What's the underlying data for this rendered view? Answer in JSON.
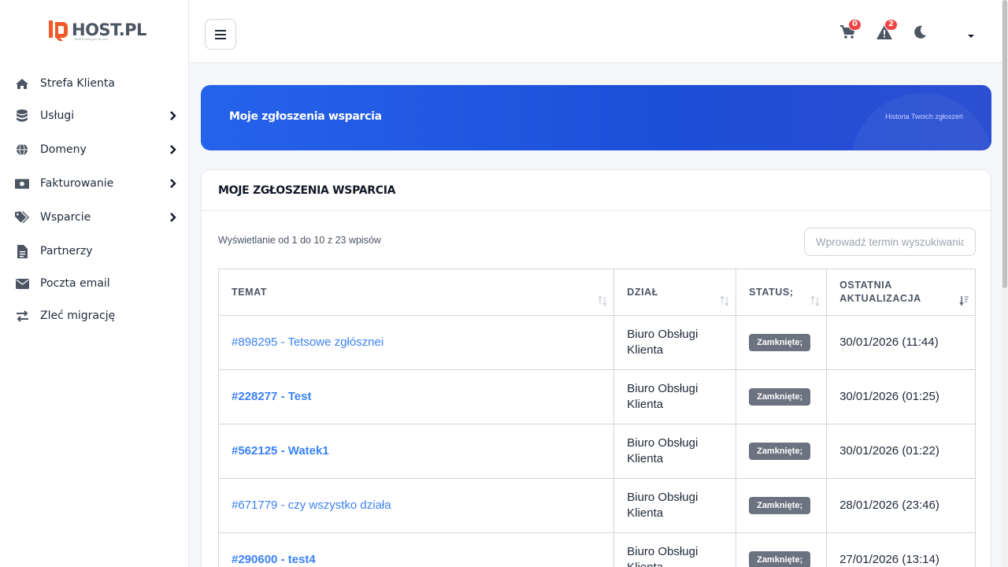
{
  "brand": {
    "name": "HOST.PL",
    "tagline": "Best hosting on the web"
  },
  "sidebar": {
    "items": [
      {
        "label": "Strefa Klienta",
        "icon": "home-icon",
        "has_submenu": false
      },
      {
        "label": "Usługi",
        "icon": "database-icon",
        "has_submenu": true
      },
      {
        "label": "Domeny",
        "icon": "globe-icon",
        "has_submenu": true
      },
      {
        "label": "Fakturowanie",
        "icon": "money-bill-icon",
        "has_submenu": true
      },
      {
        "label": "Wsparcie",
        "icon": "tags-icon",
        "has_submenu": true
      },
      {
        "label": "Partnerzy",
        "icon": "file-text-icon",
        "has_submenu": false
      },
      {
        "label": "Poczta email",
        "icon": "envelope-icon",
        "has_submenu": false
      },
      {
        "label": "Zleć migrację",
        "icon": "exchange-icon",
        "has_submenu": false
      }
    ]
  },
  "topbar": {
    "cart_count": "0",
    "alerts_count": "2"
  },
  "banner": {
    "title": "Moje zgłoszenia wsparcia",
    "subtitle": "Historia Twoich zgłoszeń"
  },
  "card": {
    "title": "MOJE ZGŁOSZENIA WSPARCIA",
    "info": "Wyświetlanie od 1 do 10 z 23 wpisów",
    "search_placeholder": "Wprowadź termin wyszukiwania"
  },
  "table": {
    "headers": [
      "TEMAT",
      "DZIAŁ",
      "STATUS;",
      "OSTATNIA AKTUALIZACJA"
    ],
    "rows": [
      {
        "subject": "#898295 - Tetsowe zgłósznei",
        "bold": false,
        "dept": "Biuro Obsługi Klienta",
        "status": "Zamknięte;",
        "updated": "30/01/2026 (11:44)"
      },
      {
        "subject": "#228277 - Test",
        "bold": true,
        "dept": "Biuro Obsługi Klienta",
        "status": "Zamknięte;",
        "updated": "30/01/2026 (01:25)"
      },
      {
        "subject": "#562125 - Watek1",
        "bold": true,
        "dept": "Biuro Obsługi Klienta",
        "status": "Zamknięte;",
        "updated": "30/01/2026 (01:22)"
      },
      {
        "subject": "#671779 - czy wszystko działa",
        "bold": false,
        "dept": "Biuro Obsługi Klienta",
        "status": "Zamknięte;",
        "updated": "28/01/2026 (23:46)"
      },
      {
        "subject": "#290600 - test4",
        "bold": true,
        "dept": "Biuro Obsługi Klienta",
        "status": "Zamknięte;",
        "updated": "27/01/2026 (13:14)"
      }
    ]
  }
}
